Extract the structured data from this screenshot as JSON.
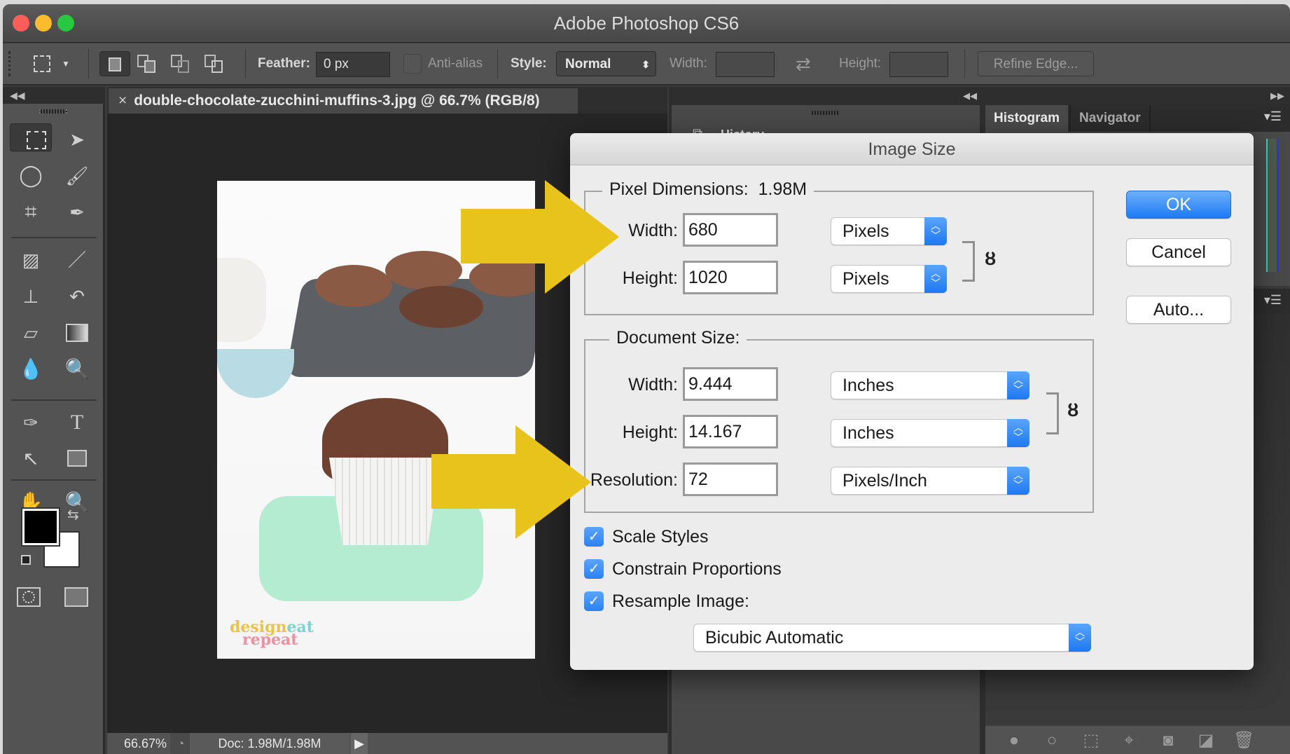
{
  "app": {
    "title": "Adobe Photoshop CS6"
  },
  "options_bar": {
    "feather_label": "Feather:",
    "feather_value": "0 px",
    "antialias_label": "Anti-alias",
    "antialias_checked": false,
    "style_label": "Style:",
    "style_value": "Normal",
    "width_label": "Width:",
    "width_value": "",
    "height_label": "Height:",
    "height_value": "",
    "refine_edge_label": "Refine Edge..."
  },
  "document": {
    "tab_title": "double-chocolate-zucchini-muffins-3.jpg @ 66.7% (RGB/8)",
    "close_glyph": "×",
    "watermark_line1a": "design",
    "watermark_line1b": "eat",
    "watermark_line2": "repeat"
  },
  "status_bar": {
    "zoom": "66.67%",
    "doc_info": "Doc: 1.98M/1.98M"
  },
  "panels": {
    "history_label": "History",
    "tabs": [
      {
        "label": "Histogram",
        "active": true
      },
      {
        "label": "Navigator",
        "active": false
      }
    ]
  },
  "dialog": {
    "title": "Image Size",
    "pixel_dimensions": {
      "legend": "Pixel Dimensions:",
      "size": "1.98M",
      "width_label": "Width:",
      "width_value": "680",
      "width_unit": "Pixels",
      "height_label": "Height:",
      "height_value": "1020",
      "height_unit": "Pixels"
    },
    "document_size": {
      "legend": "Document Size:",
      "width_label": "Width:",
      "width_value": "9.444",
      "width_unit": "Inches",
      "height_label": "Height:",
      "height_value": "14.167",
      "height_unit": "Inches",
      "resolution_label": "Resolution:",
      "resolution_value": "72",
      "resolution_unit": "Pixels/Inch"
    },
    "checkboxes": [
      {
        "label": "Scale Styles",
        "checked": true
      },
      {
        "label": "Constrain Proportions",
        "checked": true
      },
      {
        "label": "Resample Image:",
        "checked": true
      }
    ],
    "resample_method": "Bicubic Automatic",
    "buttons": {
      "ok": "OK",
      "cancel": "Cancel",
      "auto": "Auto..."
    }
  },
  "annotations": {
    "arrow_color": "#e8c31c"
  },
  "icons": {
    "check": "✓",
    "updown": "⌃⌄",
    "link": "⛓"
  }
}
